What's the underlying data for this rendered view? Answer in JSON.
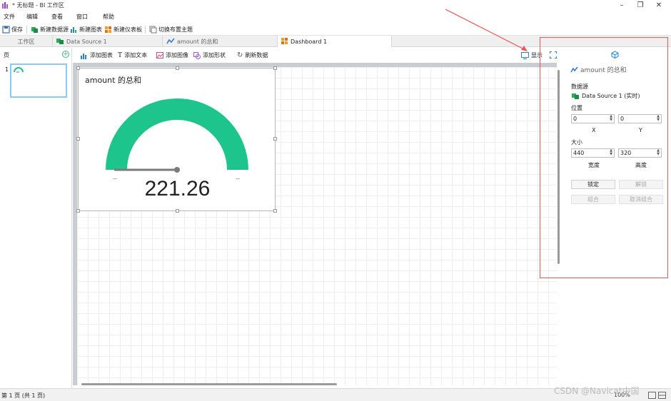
{
  "window": {
    "title": "* 无标题 - BI 工作区"
  },
  "menu": [
    "文件",
    "编辑",
    "查看",
    "窗口",
    "帮助"
  ],
  "toolbar": {
    "save": "保存",
    "new_datasource": "新建数据源",
    "new_chart": "新建图表",
    "new_dashboard": "新建仪表板",
    "switch_theme": "切换布置主题"
  },
  "tabs": [
    "工作区",
    "Data Source 1",
    "amount 的总和",
    "Dashboard 1"
  ],
  "pages": {
    "title": "页",
    "items": [
      {
        "num": "1"
      }
    ]
  },
  "canvas_toolbar": {
    "add_chart": "添加图表",
    "add_text": "添加文本",
    "add_image": "添加图像",
    "add_shape": "添加形状",
    "refresh": "刷新数据",
    "display": "显示"
  },
  "widget": {
    "title": "amount 的总和",
    "value": "221.26",
    "min_label": "--",
    "max_label": "--",
    "gauge_fraction": 0.0,
    "color": "#1dc48b"
  },
  "properties": {
    "chart_name": "amount 的总和",
    "datasource_label": "数据源",
    "datasource_value": "Data Source 1 (实时)",
    "position_label": "位置",
    "x": "0",
    "y": "0",
    "x_label": "X",
    "y_label": "Y",
    "size_label": "大小",
    "width": "440",
    "height": "320",
    "width_label": "宽度",
    "height_label": "高度",
    "lock": "锁定",
    "unlock": "解锁",
    "group": "组合",
    "ungroup": "取消组合"
  },
  "status": {
    "page_info": "第 1 页 (共 1 页)",
    "zoom": "100%"
  },
  "watermark": "CSDN @Navicat中国",
  "colors": {
    "accent": "#1dc48b",
    "highlight_border": "#e8595c",
    "tab_active": "#ffffff"
  }
}
